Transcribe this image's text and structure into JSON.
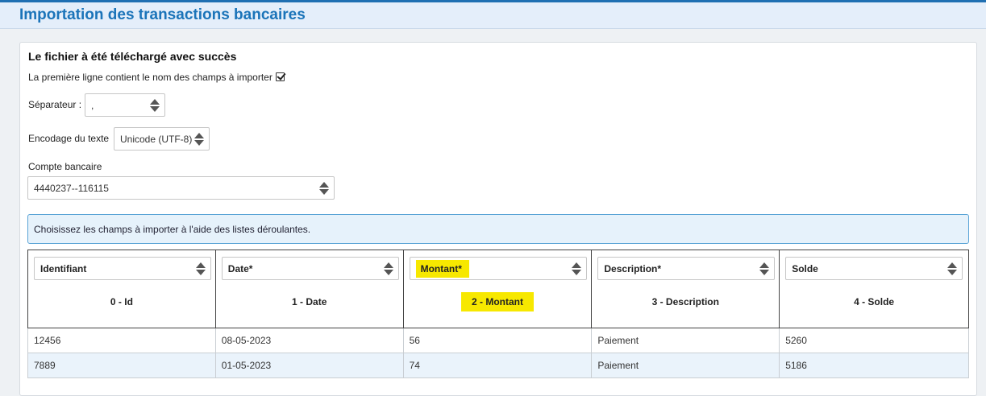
{
  "page_title": "Importation des transactions bancaires",
  "panel": {
    "title": "Le fichier à été téléchargé avec succès",
    "first_line_label": "La première ligne contient le nom des champs à importer",
    "separator_label": "Séparateur :",
    "separator_value": ",",
    "encoding_label": "Encodage du texte",
    "encoding_value": "Unicode (UTF-8)",
    "account_label": "Compte bancaire",
    "account_value": "4440237--116115",
    "info_text": "Choisissez les champs à importer à l'aide des listes déroulantes."
  },
  "columns": [
    {
      "field": "Identifiant",
      "name": "0 - Id"
    },
    {
      "field": "Date*",
      "name": "1 - Date"
    },
    {
      "field": "Montant*",
      "name": "2 - Montant"
    },
    {
      "field": "Description*",
      "name": "3 - Description"
    },
    {
      "field": "Solde",
      "name": "4 - Solde"
    }
  ],
  "rows": [
    [
      "12456",
      "08-05-2023",
      "56",
      "Paiement",
      "5260"
    ],
    [
      "7889",
      "01-05-2023",
      "74",
      "Paiement",
      "5186"
    ]
  ],
  "colors": {
    "accent": "#1b74b9",
    "highlight": "#f7e800",
    "info_border": "#5aa4d6"
  }
}
